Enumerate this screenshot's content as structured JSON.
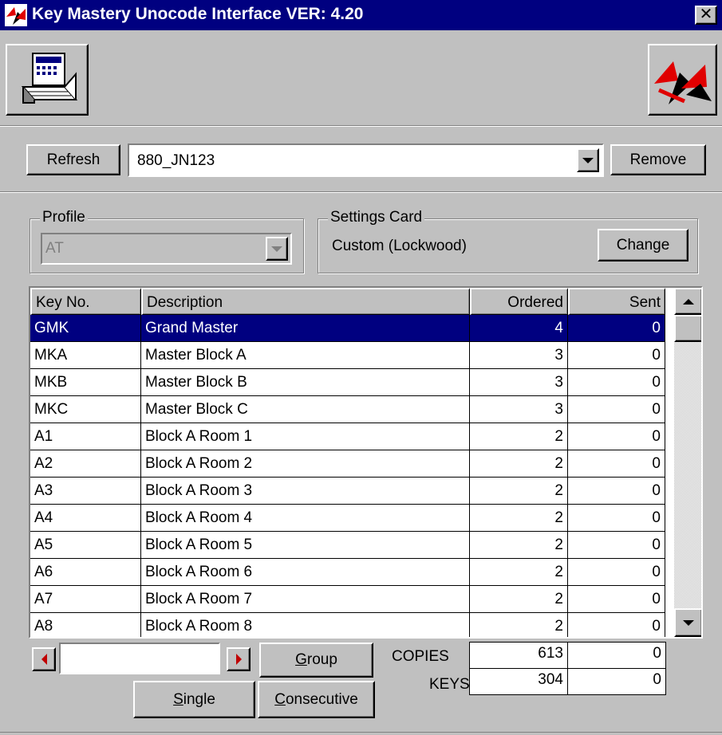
{
  "window": {
    "title": "Key Mastery Unocode Interface VER: 4.20",
    "close_glyph": "✕",
    "app_icon": "lockwood-logo-icon"
  },
  "toolbar": {
    "left_icon": "print-keys-icon",
    "right_icon": "lockwood-logo-icon"
  },
  "keyset": {
    "refresh_label": "Refresh",
    "selected": "880_JN123",
    "remove_label": "Remove"
  },
  "profile": {
    "label": "Profile",
    "value": "AT",
    "enabled": false
  },
  "settings_card": {
    "label": "Settings Card",
    "value": "Custom (Lockwood)",
    "change_label": "Change"
  },
  "table": {
    "columns": [
      "Key No.",
      "Description",
      "Ordered",
      "Sent"
    ],
    "rows": [
      {
        "key": "GMK",
        "desc": "Grand Master",
        "ordered": "4",
        "sent": "0",
        "selected": true
      },
      {
        "key": "MKA",
        "desc": "Master Block A",
        "ordered": "3",
        "sent": "0"
      },
      {
        "key": "MKB",
        "desc": "Master Block B",
        "ordered": "3",
        "sent": "0"
      },
      {
        "key": "MKC",
        "desc": "Master Block C",
        "ordered": "3",
        "sent": "0"
      },
      {
        "key": "A1",
        "desc": "Block A Room 1",
        "ordered": "2",
        "sent": "0"
      },
      {
        "key": "A2",
        "desc": "Block A Room 2",
        "ordered": "2",
        "sent": "0"
      },
      {
        "key": "A3",
        "desc": "Block A Room 3",
        "ordered": "2",
        "sent": "0"
      },
      {
        "key": "A4",
        "desc": "Block A Room 4",
        "ordered": "2",
        "sent": "0"
      },
      {
        "key": "A5",
        "desc": "Block A Room 5",
        "ordered": "2",
        "sent": "0"
      },
      {
        "key": "A6",
        "desc": "Block A Room 6",
        "ordered": "2",
        "sent": "0"
      },
      {
        "key": "A7",
        "desc": "Block A Room 7",
        "ordered": "2",
        "sent": "0"
      },
      {
        "key": "A8",
        "desc": "Block A Room 8",
        "ordered": "2",
        "sent": "0"
      }
    ]
  },
  "controls": {
    "range_value": "",
    "group_label": "Group",
    "group_hotkey": "G",
    "single_label": "Single",
    "single_hotkey": "S",
    "consecutive_label": "Consecutive",
    "consecutive_hotkey": "C"
  },
  "totals": {
    "copies_label": "COPIES",
    "copies_ordered": "613",
    "copies_sent": "0",
    "keys_label": "KEYS",
    "keys_ordered": "304",
    "keys_sent": "0"
  },
  "colors": {
    "titlebar": "#000080",
    "selection": "#000080",
    "face": "#c0c0c0",
    "arrow": "#c00000",
    "logo_red": "#e00000"
  }
}
